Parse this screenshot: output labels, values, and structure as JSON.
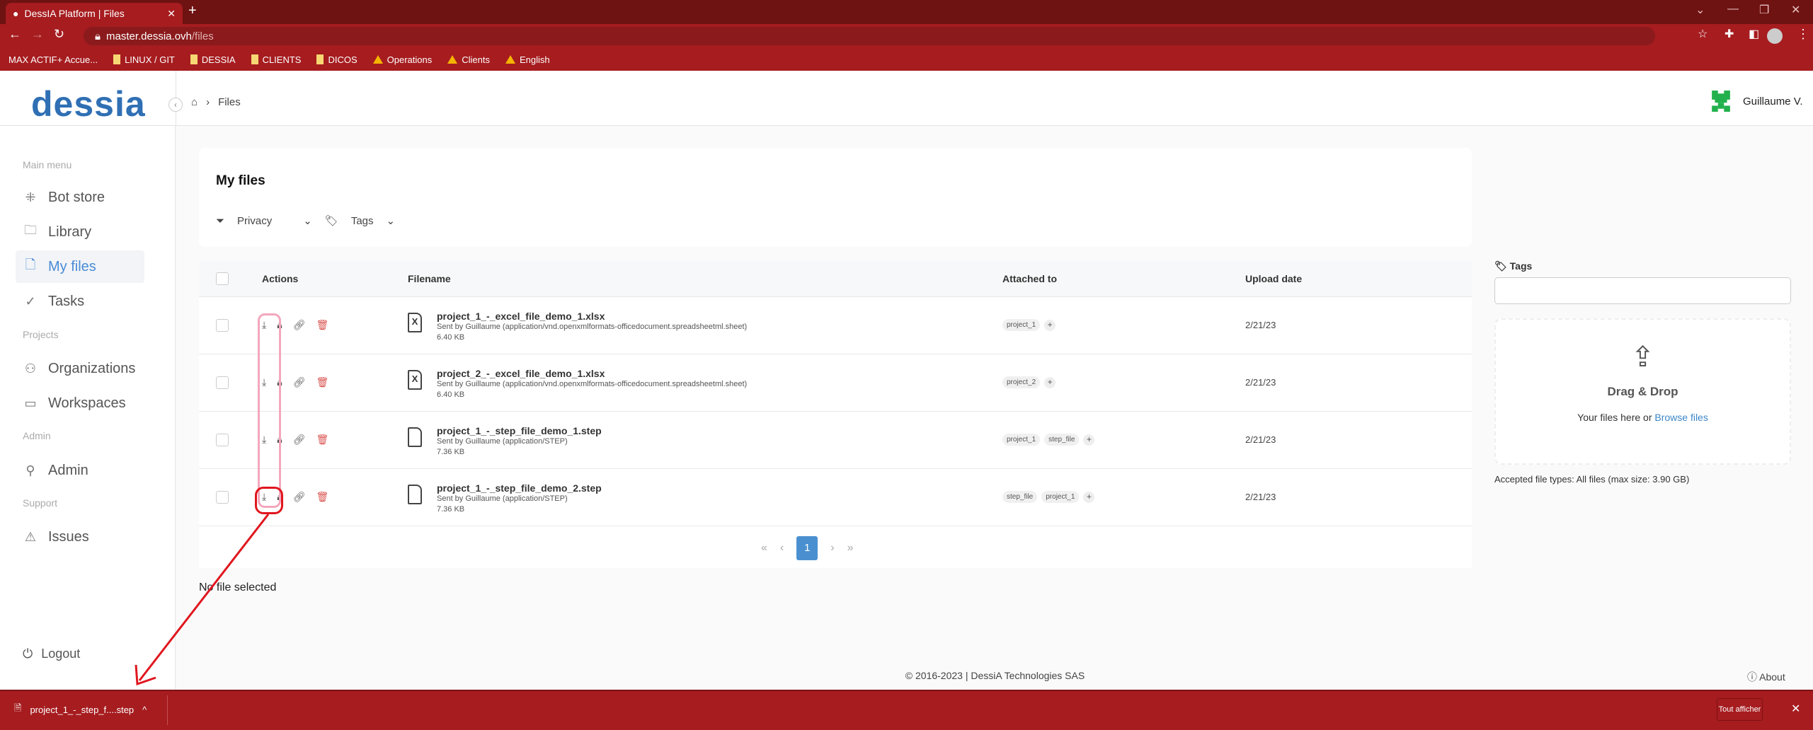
{
  "browser": {
    "tab_title": "DessIA Platform | Files",
    "url_host": "master.dessia.ovh",
    "url_path": "/files",
    "bookmarks": [
      "MAX ACTIF+ Accue...",
      "LINUX / GIT",
      "DESSIA",
      "CLIENTS",
      "DICOS",
      "Operations",
      "Clients",
      "English"
    ]
  },
  "header": {
    "logo": "dessia",
    "breadcrumb": "Files",
    "user": "Guillaume V.",
    "accent": "#4a90d0"
  },
  "sidebar": {
    "sections": [
      "Main menu",
      "Projects",
      "Admin",
      "Support"
    ],
    "items": [
      {
        "label": "Bot store",
        "icon": "bot-store-icon"
      },
      {
        "label": "Library",
        "icon": "folder-icon"
      },
      {
        "label": "My files",
        "icon": "file-icon",
        "active": true
      },
      {
        "label": "Tasks",
        "icon": "check-circle-icon"
      },
      {
        "label": "Organizations",
        "icon": "organization-icon"
      },
      {
        "label": "Workspaces",
        "icon": "briefcase-icon"
      },
      {
        "label": "Admin",
        "icon": "user-icon"
      },
      {
        "label": "Issues",
        "icon": "warning-icon"
      }
    ],
    "logout": "Logout"
  },
  "main": {
    "title": "My files",
    "filters": [
      "Privacy",
      "Tags"
    ],
    "columns": [
      "Actions",
      "Filename",
      "Attached to",
      "Upload date"
    ],
    "rows": [
      {
        "name": "project_1_-_excel_file_demo_1.xlsx",
        "sent": "Sent by Guillaume (application/vnd.openxmlformats-officedocument.spreadsheetml.sheet)",
        "size": "6.40 KB",
        "type": "X",
        "tags": [
          "project_1"
        ],
        "date": "2/21/23"
      },
      {
        "name": "project_2_-_excel_file_demo_1.xlsx",
        "sent": "Sent by Guillaume (application/vnd.openxmlformats-officedocument.spreadsheetml.sheet)",
        "size": "6.40 KB",
        "type": "X",
        "tags": [
          "project_2"
        ],
        "date": "2/21/23"
      },
      {
        "name": "project_1_-_step_file_demo_1.step",
        "sent": "Sent by Guillaume (application/STEP)",
        "size": "7.36 KB",
        "type": "",
        "tags": [
          "project_1",
          "step_file"
        ],
        "date": "2/21/23"
      },
      {
        "name": "project_1_-_step_file_demo_2.step",
        "sent": "Sent by Guillaume (application/STEP)",
        "size": "7.36 KB",
        "type": "",
        "tags": [
          "step_file",
          "project_1"
        ],
        "date": "2/21/23"
      }
    ],
    "pagination": {
      "current": "1"
    },
    "no_selection": "No file selected"
  },
  "upload": {
    "tags_label": "Tags",
    "drag": "Drag & Drop",
    "your_files": "Your files here or",
    "browse": "Browse files",
    "accepted": "Accepted file types: All files (max size: 3.90 GB)"
  },
  "footer": {
    "copyright": "© 2016-2023 | DessiA Technologies SAS",
    "about": "About"
  },
  "download_bar": {
    "file": "project_1_-_step_f....step",
    "show_all": "Tout afficher"
  },
  "annotations": {
    "highlight_color": "#f4a7bd",
    "selected_color": "#e0161e"
  }
}
